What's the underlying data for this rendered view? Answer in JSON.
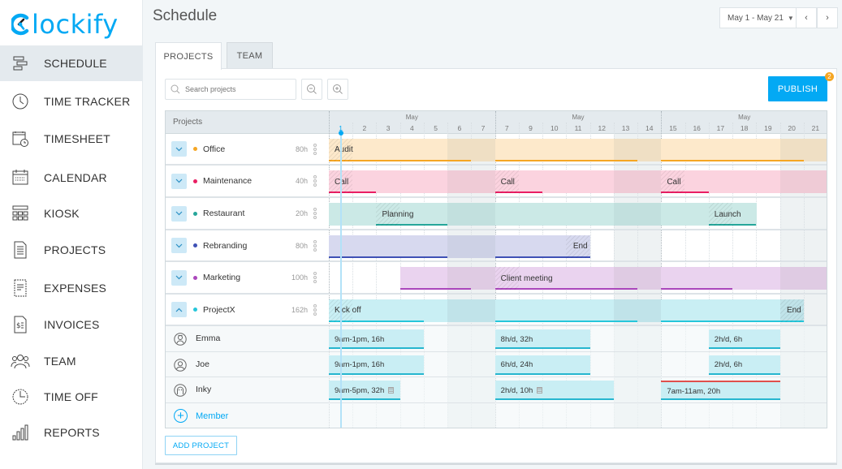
{
  "app": {
    "logo_text": "lockify",
    "brand_color": "#03a9f4"
  },
  "sidebar": {
    "items": [
      {
        "label": "SCHEDULE",
        "icon": "schedule-icon",
        "active": true
      },
      {
        "label": "TIME TRACKER",
        "icon": "clock-icon",
        "active": false
      },
      {
        "label": "TIMESHEET",
        "icon": "timesheet-icon",
        "active": false
      },
      {
        "label": "CALENDAR",
        "icon": "calendar-icon",
        "active": false
      },
      {
        "label": "KIOSK",
        "icon": "kiosk-icon",
        "active": false
      },
      {
        "label": "PROJECTS",
        "icon": "document-icon",
        "active": false
      },
      {
        "label": "EXPENSES",
        "icon": "receipt-icon",
        "active": false
      },
      {
        "label": "INVOICES",
        "icon": "invoice-icon",
        "active": false
      },
      {
        "label": "TEAM",
        "icon": "team-icon",
        "active": false
      },
      {
        "label": "TIME OFF",
        "icon": "time-off-icon",
        "active": false
      },
      {
        "label": "REPORTS",
        "icon": "reports-icon",
        "active": false
      }
    ]
  },
  "header": {
    "title": "Schedule",
    "date_range": "May 1 - May 21",
    "prev_label": "‹",
    "next_label": "›"
  },
  "tabs": [
    {
      "label": "PROJECTS",
      "active": true
    },
    {
      "label": "TEAM",
      "active": false
    }
  ],
  "toolbar": {
    "search_placeholder": "Search projects",
    "search_value": "",
    "publish_label": "PUBLISH",
    "publish_badge": "2"
  },
  "grid": {
    "left_header": "Projects",
    "months": [
      {
        "label": "May",
        "over_col": 3
      },
      {
        "label": "May",
        "over_col": 10
      },
      {
        "label": "May",
        "over_col": 17
      }
    ],
    "days": [
      "1",
      "2",
      "3",
      "4",
      "5",
      "6",
      "7",
      "7",
      "9",
      "10",
      "11",
      "12",
      "13",
      "14",
      "15",
      "16",
      "17",
      "18",
      "19",
      "20",
      "21"
    ],
    "weekend_cols": [
      5,
      6,
      12,
      13,
      19,
      20
    ],
    "week_breaks": [
      7,
      14
    ],
    "today_col": 0,
    "projects": [
      {
        "name": "Office",
        "hours": "80h",
        "color": "#f5a623",
        "bg": "#fde9cb",
        "wbg": "#efdfc4",
        "expanded": false,
        "range": [
          0,
          20
        ],
        "lines": [
          [
            0,
            5
          ],
          [
            7,
            12
          ],
          [
            14,
            19
          ]
        ],
        "labels": [
          {
            "text": "Audit",
            "col": 0
          }
        ]
      },
      {
        "name": "Maintenance",
        "hours": "40h",
        "color": "#e91e63",
        "bg": "#fbd3df",
        "wbg": "#efcbd6",
        "expanded": false,
        "range": [
          0,
          20
        ],
        "lines": [
          [
            0,
            1
          ],
          [
            7,
            8
          ],
          [
            14,
            15
          ]
        ],
        "labels": [
          {
            "text": "Call",
            "col": 0
          },
          {
            "text": "Call",
            "col": 7
          },
          {
            "text": "Call",
            "col": 14
          }
        ]
      },
      {
        "name": "Restaurant",
        "hours": "20h",
        "color": "#26a69a",
        "bg": "#cbe9e6",
        "wbg": "#c2e0de",
        "expanded": false,
        "range": [
          0,
          17
        ],
        "lines": [
          [
            2,
            4
          ],
          [
            16,
            17
          ]
        ],
        "labels": [
          {
            "text": "Planning",
            "col": 2
          },
          {
            "text": "Launch",
            "col": 16
          }
        ]
      },
      {
        "name": "Rebranding",
        "hours": "80h",
        "color": "#3f51b5",
        "bg": "#d7d9ef",
        "wbg": "#cdd1e5",
        "expanded": false,
        "range": [
          0,
          10
        ],
        "lines": [
          [
            0,
            4
          ],
          [
            7,
            10
          ]
        ],
        "labels": [
          {
            "text": "End",
            "col": 10
          }
        ]
      },
      {
        "name": "Marketing",
        "hours": "100h",
        "color": "#ab47bc",
        "bg": "#ead3ef",
        "wbg": "#dfcbe3",
        "expanded": false,
        "range": [
          3,
          20
        ],
        "lines": [
          [
            3,
            5
          ],
          [
            7,
            12
          ],
          [
            14,
            16
          ]
        ],
        "labels": [
          {
            "text": "Client meeting",
            "col": 7
          }
        ]
      },
      {
        "name": "ProjectX",
        "hours": "162h",
        "color": "#26c6da",
        "bg": "#c9eff4",
        "wbg": "#c0e3e9",
        "expanded": true,
        "range": [
          0,
          19
        ],
        "lines": [
          [
            0,
            3
          ],
          [
            7,
            12
          ],
          [
            14,
            19
          ]
        ],
        "labels": [
          {
            "text": "Kick off",
            "col": 0
          },
          {
            "text": "End",
            "col": 19
          }
        ]
      }
    ],
    "members": [
      {
        "name": "Emma",
        "avatar": "emma-avatar-icon",
        "assignments": [
          {
            "text": "9am-1pm, 16h",
            "from": 0,
            "to": 3
          },
          {
            "text": "8h/d, 32h",
            "from": 7,
            "to": 10
          },
          {
            "text": "2h/d, 6h",
            "from": 16,
            "to": 18
          }
        ]
      },
      {
        "name": "Joe",
        "avatar": "joe-avatar-icon",
        "assignments": [
          {
            "text": "9am-1pm, 16h",
            "from": 0,
            "to": 3
          },
          {
            "text": "6h/d, 24h",
            "from": 7,
            "to": 10
          },
          {
            "text": "2h/d, 6h",
            "from": 16,
            "to": 18
          }
        ]
      },
      {
        "name": "Inky",
        "avatar": "inky-avatar-icon",
        "assignments": [
          {
            "text": "9am-5pm, 32h",
            "from": 0,
            "to": 2,
            "note": true
          },
          {
            "text": "2h/d, 10h",
            "from": 7,
            "to": 11,
            "note": true
          },
          {
            "text": "7am-11am, 20h",
            "from": 14,
            "to": 18,
            "conflict": true
          }
        ]
      }
    ],
    "add_member_label": "Member"
  },
  "footer": {
    "add_project_label": "ADD PROJECT"
  }
}
